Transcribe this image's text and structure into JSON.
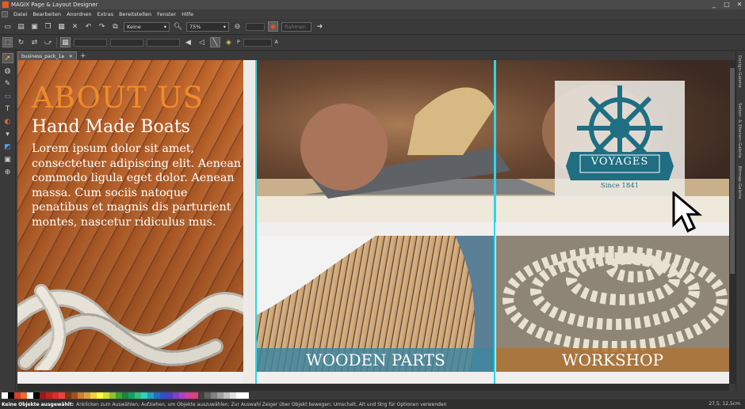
{
  "window": {
    "title": "MAGIX Page & Layout Designer",
    "controls": [
      "_",
      "□",
      "✕"
    ]
  },
  "menu": [
    "Datei",
    "Bearbeiten",
    "Anordnen",
    "Extras",
    "Bereitstellen",
    "Fenster",
    "Hilfe"
  ],
  "toolbar": {
    "style_select": "Keine",
    "zoom_select": "75%",
    "mode_select": "Rahmen"
  },
  "toolbar2": {
    "p_label": "P",
    "a_label": "A"
  },
  "tabs": {
    "active": "business_pack_1a",
    "add": "+"
  },
  "page": {
    "about_title": "ABOUT US",
    "subtitle": "Hand Made Boats",
    "body": "Lorem ipsum dolor sit amet, consectetuer adipiscing elit. Aenean commodo ligula eget dolor. Aenean massa. Cum sociis natoque penatibus et magnis dis parturient montes, nascetur ridiculus mus.",
    "caption_wooden": "WOODEN PARTS",
    "caption_workshop": "WORKSHOP",
    "logo_word": "VOYAGES",
    "logo_since": "Since 1841"
  },
  "right_panel_tabs": [
    "Design-Galerie",
    "Seiten- & Ebenen-Galerie",
    "Bitmap-Galerie"
  ],
  "status": {
    "bold": "Keine Objekte ausgewählt:",
    "hint": "Anklicken zum Auswählen; Aufziehen, um Objekte auszuwählen; Zur Auswahl Zeiger über Objekt bewegen; Umschalt, Alt und Strg für Optionen verwenden",
    "coords": "27,5, 12,5cm"
  },
  "colors": {
    "accent_orange": "#ef8b2c",
    "guide": "#2ad9e8",
    "logo_teal": "#1f6e82",
    "palette": [
      "#ffffff",
      "#000000",
      "#e03a2a",
      "#f06a2a",
      "#ffffff",
      "#000000",
      "#9a1a1a",
      "#c02020",
      "#e02a2a",
      "#f04040",
      "#7a3a10",
      "#a05020",
      "#d08030",
      "#e0a040",
      "#f0d040",
      "#ffff40",
      "#d0e040",
      "#90c030",
      "#40a030",
      "#208040",
      "#10a060",
      "#30c080",
      "#30d0c0",
      "#20a0c0",
      "#2070c0",
      "#3050d0",
      "#5040c0",
      "#8040c0",
      "#b040c0",
      "#d040a0",
      "#e04080",
      "#404040",
      "#606060",
      "#808080",
      "#a0a0a0",
      "#c0c0c0",
      "#e0e0e0",
      "#ffffff",
      "#ffffff"
    ]
  }
}
